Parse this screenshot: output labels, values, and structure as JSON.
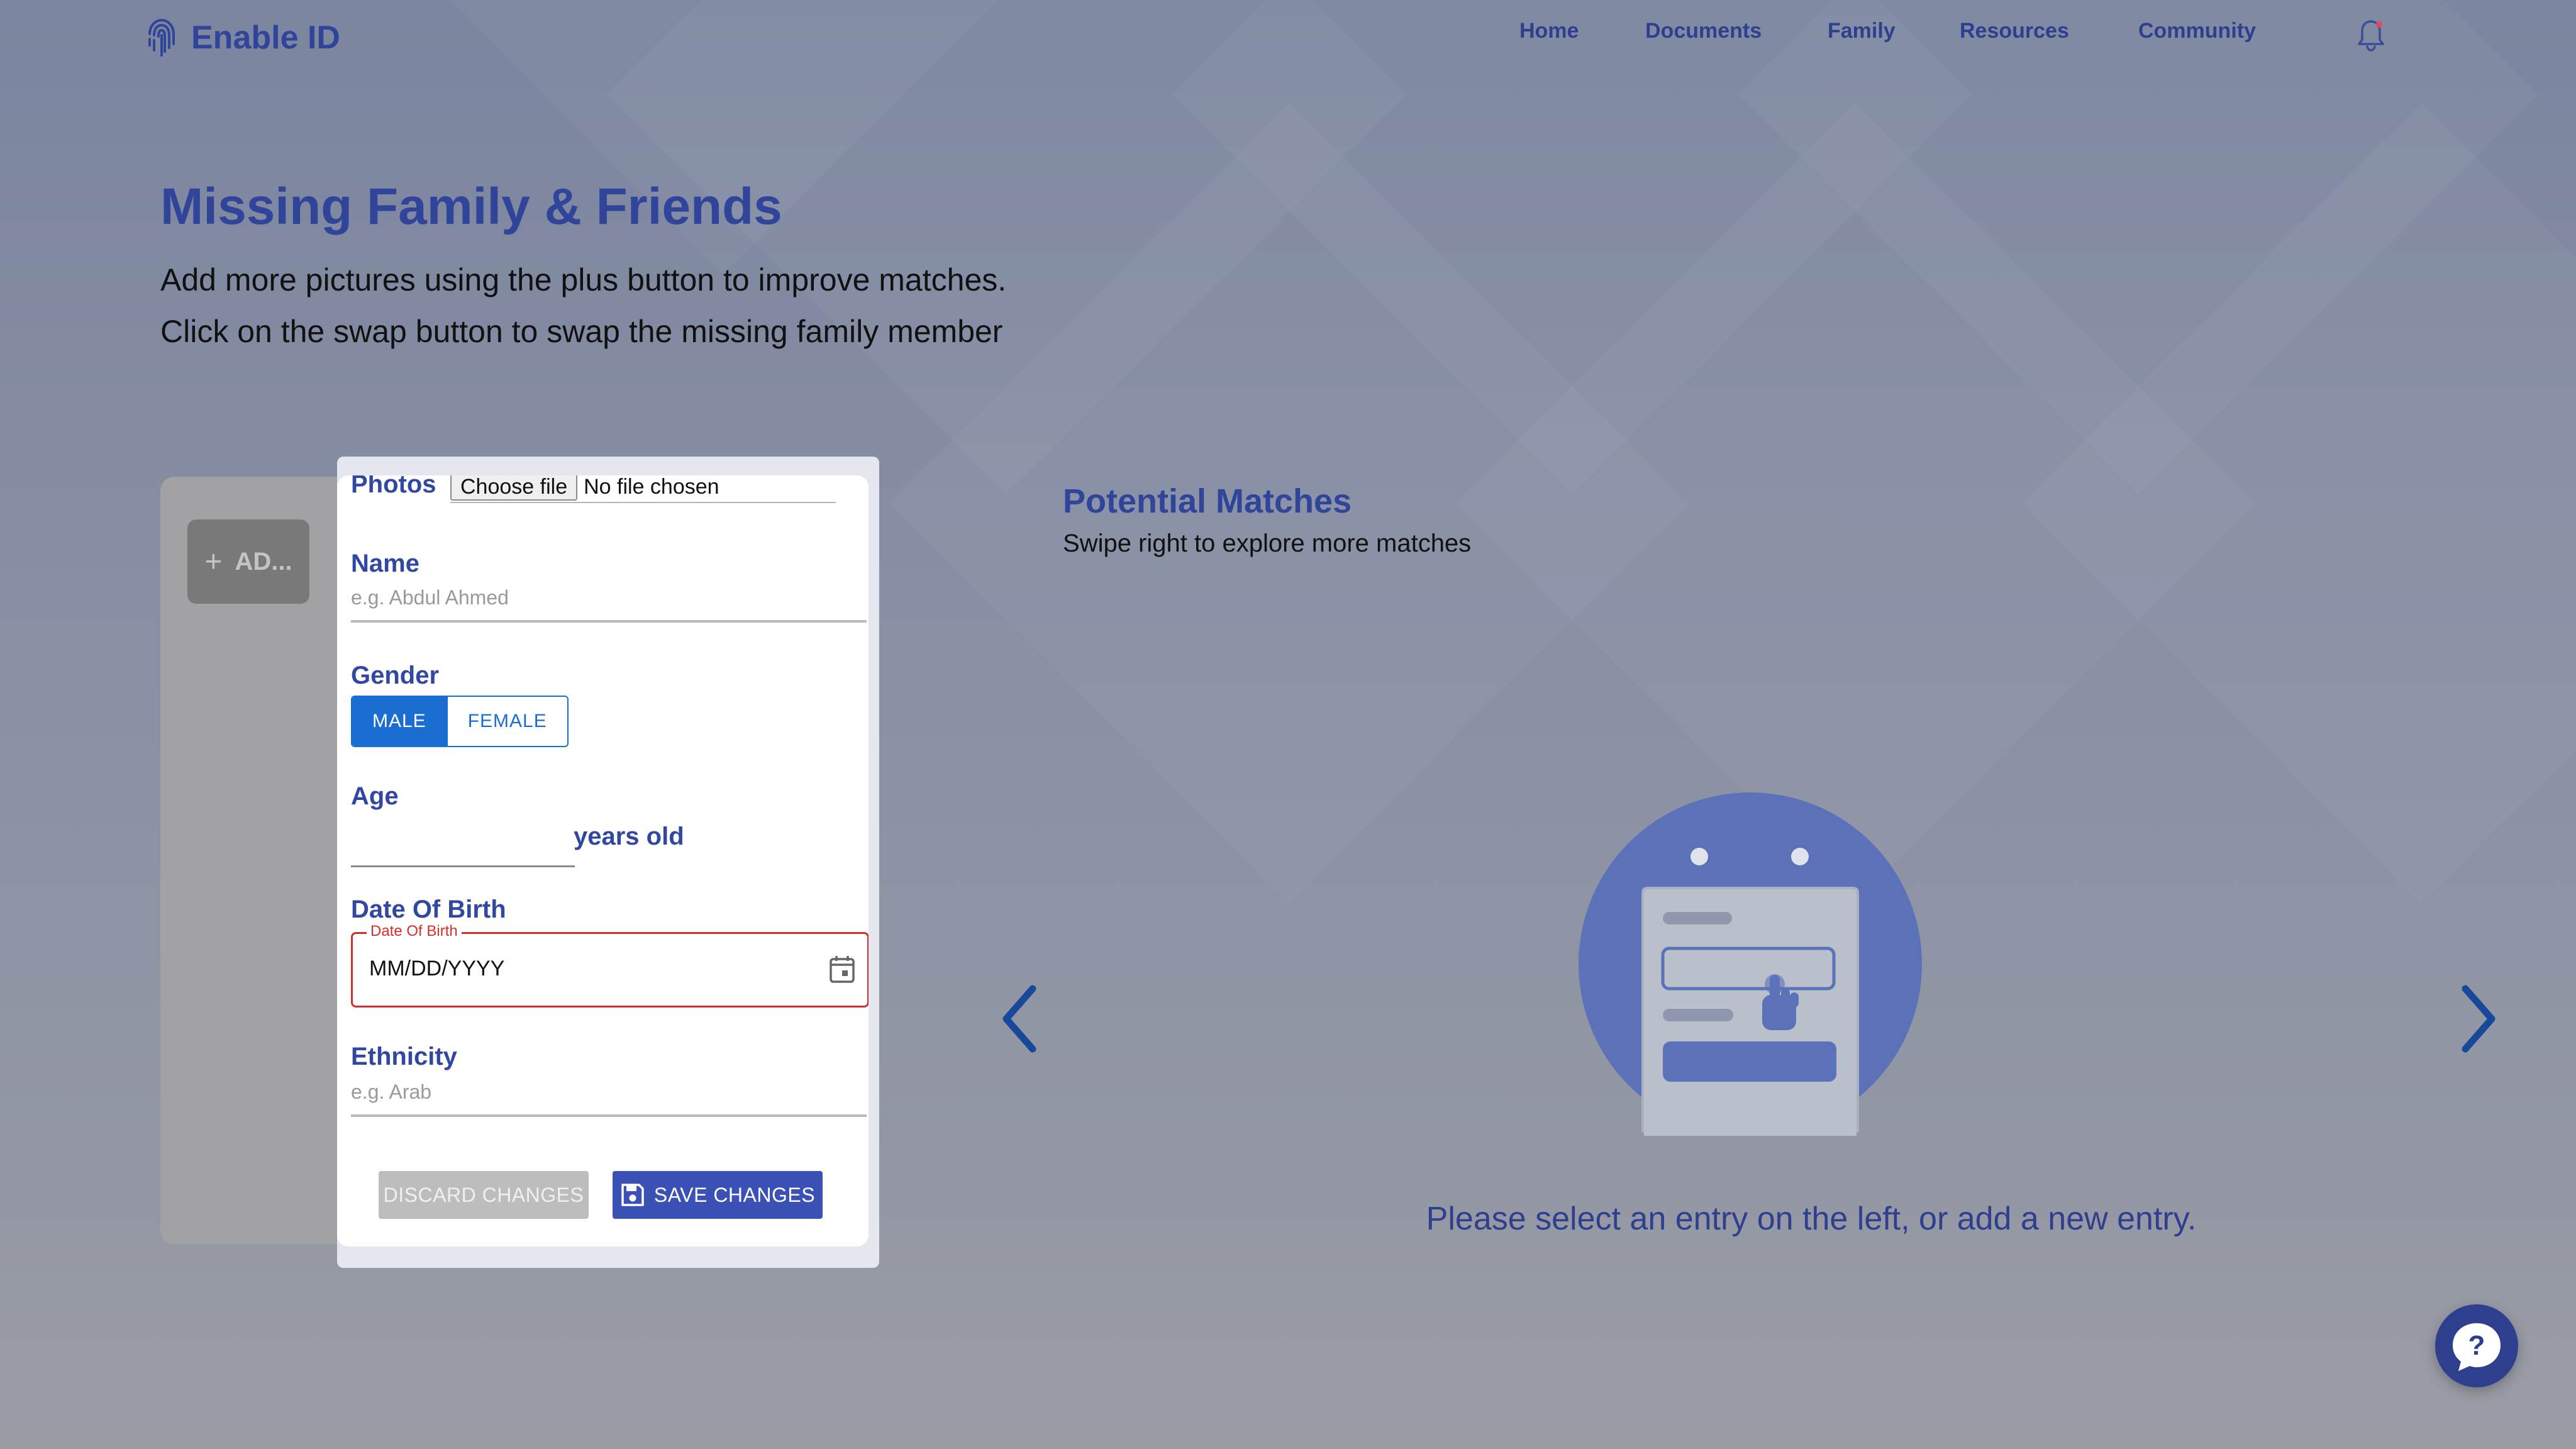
{
  "app": {
    "name": "Enable ID"
  },
  "nav": {
    "items": [
      {
        "label": "Home"
      },
      {
        "label": "Documents"
      },
      {
        "label": "Family"
      },
      {
        "label": "Resources"
      },
      {
        "label": "Community"
      }
    ]
  },
  "page": {
    "title": "Missing Family & Friends",
    "instructions": [
      "Add more pictures using the plus button to improve matches.",
      "Click on the swap button to swap the missing family member"
    ]
  },
  "entries": {
    "add_label": "AD..."
  },
  "form": {
    "photos": {
      "label": "Photos",
      "button": "Choose file",
      "status": "No file chosen"
    },
    "name": {
      "label": "Name",
      "placeholder": "e.g. Abdul Ahmed"
    },
    "gender": {
      "label": "Gender",
      "options": [
        "MALE",
        "FEMALE"
      ],
      "selected": "MALE"
    },
    "age": {
      "label": "Age",
      "suffix": "years old"
    },
    "dob": {
      "label": "Date Of Birth",
      "field_label": "Date Of Birth",
      "placeholder": "MM/DD/YYYY"
    },
    "ethnicity": {
      "label": "Ethnicity",
      "placeholder": "e.g. Arab"
    },
    "discard_label": "DISCARD CHANGES",
    "save_label": "SAVE CHANGES"
  },
  "matches": {
    "title": "Potential Matches",
    "subtitle": "Swipe right to explore more matches",
    "empty_message": "Please select an entry on the left, or add a new entry."
  },
  "help": {
    "label": "?"
  },
  "colors": {
    "brand": "#30449a",
    "primary_button": "#3b51b5",
    "toggle_active": "#1b6ed1",
    "error": "#d32f2f",
    "illustration": "#5b72b8"
  },
  "icons": {
    "logo": "fingerprint-icon",
    "notifications": "bell-icon",
    "calendar": "calendar-icon",
    "save": "floppy-disk-icon",
    "prev": "chevron-left-icon",
    "next": "chevron-right-icon",
    "help": "question-chat-icon"
  }
}
